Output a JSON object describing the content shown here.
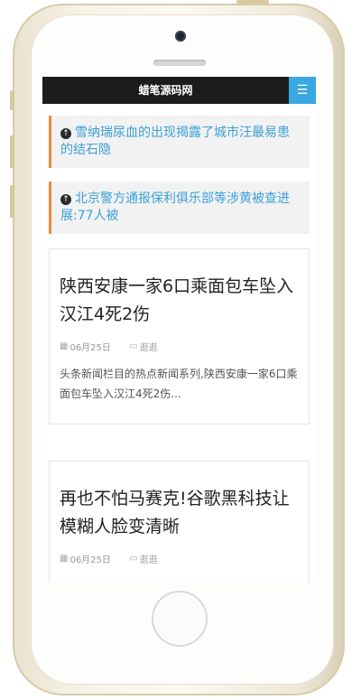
{
  "header": {
    "site_title": "蜡笔源码网",
    "menu_icon": "menu-icon",
    "menu_glyph": "☰"
  },
  "colors": {
    "accent": "#3aa8e0",
    "notice_border": "#f08a3c",
    "link": "#3aa0d8",
    "topbar": "#1c1c1c"
  },
  "notices": [
    {
      "icon": "arrow-up-circle-icon",
      "text": "雪纳瑞尿血的出现揭露了城市汪最易患的结石隐"
    },
    {
      "icon": "arrow-up-circle-icon",
      "text": "北京警方通报保利俱乐部等涉黄被查进展:77人被"
    }
  ],
  "posts": [
    {
      "title": "陕西安康一家6口乘面包车坠入汉江4死2伤",
      "date": "06月25日",
      "category": "逛逛",
      "excerpt": "头条新闻栏目的热点新闻系列,陕西安康一家6口乘面包车坠入汉江4死2伤..."
    },
    {
      "title": "再也不怕马赛克!谷歌黑科技让模糊人脸变清晰",
      "date": "06月25日",
      "category": "逛逛"
    }
  ]
}
